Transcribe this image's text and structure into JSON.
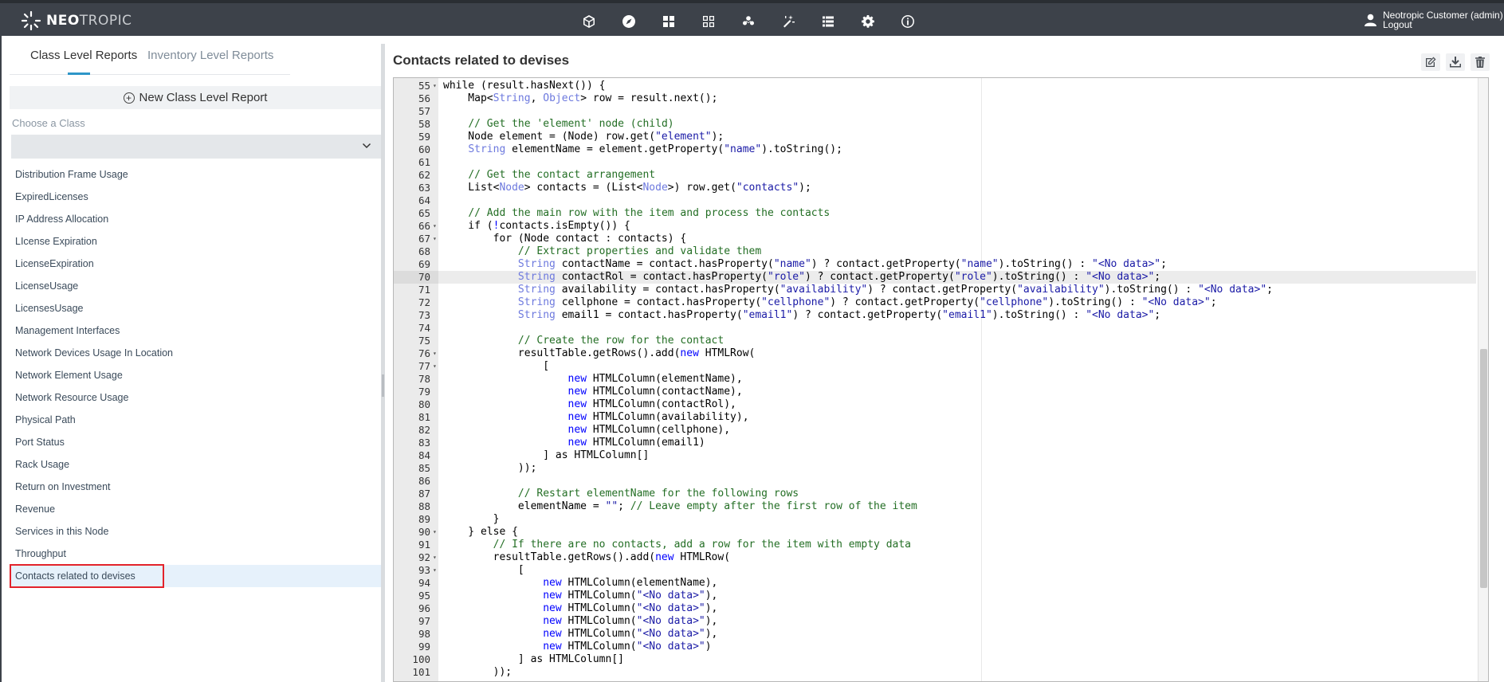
{
  "app": {
    "logo_bold": "NEO",
    "logo_light": "TROPIC",
    "nav_icons": [
      "cube-icon",
      "compass-icon",
      "grid-icon",
      "apps-icon",
      "people-icon",
      "magic-wand-icon",
      "list-icon",
      "gear-icon",
      "info-icon"
    ]
  },
  "user": {
    "name": "Neotropic Customer (admin)",
    "logout": "Logout"
  },
  "left_panel": {
    "tabs": [
      {
        "label": "Class Level Reports",
        "active": true
      },
      {
        "label": "Inventory Level Reports",
        "active": false
      }
    ],
    "new_button": "New Class Level Report",
    "choose_label": "Choose a Class",
    "select_value": "",
    "reports": [
      "Distribution Frame Usage",
      "ExpiredLicenses",
      "IP Address Allocation",
      "LIcense Expiration",
      "LicenseExpiration",
      "LicenseUsage",
      "LicensesUsage",
      "Management Interfaces",
      "Network Devices Usage In Location",
      "Network Element Usage",
      "Network Resource Usage",
      "Physical Path",
      "Port Status",
      "Rack Usage",
      "Return on Investment",
      "Revenue",
      "Services in this Node",
      "Throughput",
      "Contacts related to devises"
    ],
    "selected_index": 18
  },
  "right_panel": {
    "title": "Contacts related to devises",
    "actions": [
      "edit-icon",
      "download-icon",
      "trash-icon"
    ],
    "active_line": 70,
    "code": [
      {
        "n": 55,
        "fold": true,
        "text": "while (result.hasNext()) {"
      },
      {
        "n": 56,
        "text": "    Map<String, Object> row = result.next();"
      },
      {
        "n": 57,
        "text": ""
      },
      {
        "n": 58,
        "text": "    // Get the 'element' node (child)"
      },
      {
        "n": 59,
        "text": "    Node element = (Node) row.get(\"element\");"
      },
      {
        "n": 60,
        "text": "    String elementName = element.getProperty(\"name\").toString();"
      },
      {
        "n": 61,
        "text": ""
      },
      {
        "n": 62,
        "text": "    // Get the contact arrangement"
      },
      {
        "n": 63,
        "text": "    List<Node> contacts = (List<Node>) row.get(\"contacts\");"
      },
      {
        "n": 64,
        "text": ""
      },
      {
        "n": 65,
        "text": "    // Add the main row with the item and process the contacts"
      },
      {
        "n": 66,
        "fold": true,
        "text": "    if (!contacts.isEmpty()) {"
      },
      {
        "n": 67,
        "fold": true,
        "text": "        for (Node contact : contacts) {"
      },
      {
        "n": 68,
        "text": "            // Extract properties and validate them"
      },
      {
        "n": 69,
        "text": "            String contactName = contact.hasProperty(\"name\") ? contact.getProperty(\"name\").toString() : \"<No data>\";"
      },
      {
        "n": 70,
        "text": "            String contactRol = contact.hasProperty(\"role\") ? contact.getProperty(\"role\").toString() : \"<No data>\";"
      },
      {
        "n": 71,
        "text": "            String availability = contact.hasProperty(\"availability\") ? contact.getProperty(\"availability\").toString() : \"<No data>\";"
      },
      {
        "n": 72,
        "text": "            String cellphone = contact.hasProperty(\"cellphone\") ? contact.getProperty(\"cellphone\").toString() : \"<No data>\";"
      },
      {
        "n": 73,
        "text": "            String email1 = contact.hasProperty(\"email1\") ? contact.getProperty(\"email1\").toString() : \"<No data>\";"
      },
      {
        "n": 74,
        "text": ""
      },
      {
        "n": 75,
        "text": "            // Create the row for the contact"
      },
      {
        "n": 76,
        "fold": true,
        "text": "            resultTable.getRows().add(new HTMLRow("
      },
      {
        "n": 77,
        "fold": true,
        "text": "                ["
      },
      {
        "n": 78,
        "text": "                    new HTMLColumn(elementName),"
      },
      {
        "n": 79,
        "text": "                    new HTMLColumn(contactName),"
      },
      {
        "n": 80,
        "text": "                    new HTMLColumn(contactRol),"
      },
      {
        "n": 81,
        "text": "                    new HTMLColumn(availability),"
      },
      {
        "n": 82,
        "text": "                    new HTMLColumn(cellphone),"
      },
      {
        "n": 83,
        "text": "                    new HTMLColumn(email1)"
      },
      {
        "n": 84,
        "text": "                ] as HTMLColumn[]"
      },
      {
        "n": 85,
        "text": "            ));"
      },
      {
        "n": 86,
        "text": ""
      },
      {
        "n": 87,
        "text": "            // Restart elementName for the following rows"
      },
      {
        "n": 88,
        "text": "            elementName = \"\"; // Leave empty after the first row of the item"
      },
      {
        "n": 89,
        "text": "        }"
      },
      {
        "n": 90,
        "fold": true,
        "text": "    } else {"
      },
      {
        "n": 91,
        "text": "        // If there are no contacts, add a row for the item with empty data"
      },
      {
        "n": 92,
        "fold": true,
        "text": "        resultTable.getRows().add(new HTMLRow("
      },
      {
        "n": 93,
        "fold": true,
        "text": "            ["
      },
      {
        "n": 94,
        "text": "                new HTMLColumn(elementName),"
      },
      {
        "n": 95,
        "text": "                new HTMLColumn(\"<No data>\"),"
      },
      {
        "n": 96,
        "text": "                new HTMLColumn(\"<No data>\"),"
      },
      {
        "n": 97,
        "text": "                new HTMLColumn(\"<No data>\"),"
      },
      {
        "n": 98,
        "text": "                new HTMLColumn(\"<No data>\"),"
      },
      {
        "n": 99,
        "text": "                new HTMLColumn(\"<No data>\")"
      },
      {
        "n": 100,
        "text": "            ] as HTMLColumn[]"
      },
      {
        "n": 101,
        "text": "        ));"
      }
    ]
  },
  "colors": {
    "topbar": "#3d424a",
    "accent": "#2e96c8",
    "selection_outline": "#e3232b",
    "selected_row": "#e6f1fb",
    "comment": "#236e24",
    "string": "#1a1aa6",
    "keyword": "#0000ff",
    "type": "#6d79de"
  }
}
